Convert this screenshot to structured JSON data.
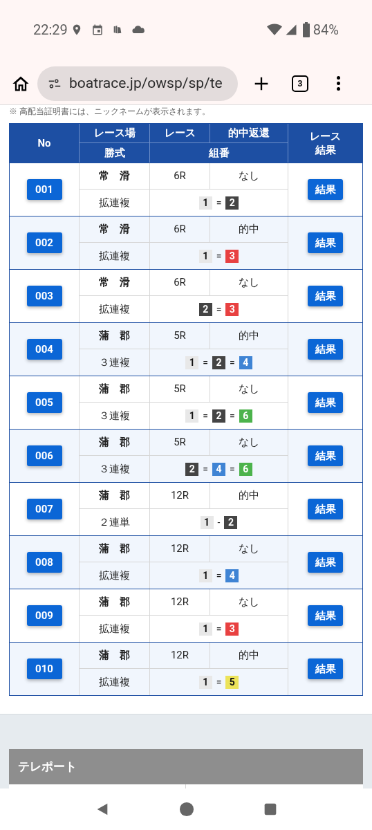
{
  "status_bar": {
    "time": "22:29",
    "battery": "84%"
  },
  "browser": {
    "url": "boatrace.jp/owsp/sp/te",
    "tab_count": "3"
  },
  "notice": "※ 高配当証明書には、ニックネームが表示されます。",
  "table": {
    "header": {
      "no": "No",
      "venue": "レース場",
      "race": "レース",
      "hit": "的中返還",
      "bet_type": "勝式",
      "combo": "組番",
      "result": [
        "レース",
        "結果"
      ]
    },
    "rows": [
      {
        "no": "001",
        "venue": "常　滑",
        "race": "6R",
        "hit": "なし",
        "bet_type": "拡連複",
        "separator": "=",
        "picks": [
          {
            "num": "1",
            "color": "#e8e8e8"
          },
          {
            "num": "2",
            "color": "#444444"
          }
        ],
        "button": "結果"
      },
      {
        "no": "002",
        "venue": "常　滑",
        "race": "6R",
        "hit": "的中",
        "bet_type": "拡連複",
        "separator": "=",
        "picks": [
          {
            "num": "1",
            "color": "#e8e8e8"
          },
          {
            "num": "3",
            "color": "#e84141"
          }
        ],
        "button": "結果"
      },
      {
        "no": "003",
        "venue": "常　滑",
        "race": "6R",
        "hit": "なし",
        "bet_type": "拡連複",
        "separator": "=",
        "picks": [
          {
            "num": "2",
            "color": "#444444"
          },
          {
            "num": "3",
            "color": "#e84141"
          }
        ],
        "button": "結果"
      },
      {
        "no": "004",
        "venue": "蒲　郡",
        "race": "5R",
        "hit": "的中",
        "bet_type": "３連複",
        "separator": "=",
        "picks": [
          {
            "num": "1",
            "color": "#e8e8e8"
          },
          {
            "num": "2",
            "color": "#444444"
          },
          {
            "num": "4",
            "color": "#3f84d4"
          }
        ],
        "button": "結果"
      },
      {
        "no": "005",
        "venue": "蒲　郡",
        "race": "5R",
        "hit": "なし",
        "bet_type": "３連複",
        "separator": "=",
        "picks": [
          {
            "num": "1",
            "color": "#e8e8e8"
          },
          {
            "num": "2",
            "color": "#444444"
          },
          {
            "num": "6",
            "color": "#4cb34c"
          }
        ],
        "button": "結果"
      },
      {
        "no": "006",
        "venue": "蒲　郡",
        "race": "5R",
        "hit": "なし",
        "bet_type": "３連複",
        "separator": "=",
        "picks": [
          {
            "num": "2",
            "color": "#444444"
          },
          {
            "num": "4",
            "color": "#3f84d4"
          },
          {
            "num": "6",
            "color": "#4cb34c"
          }
        ],
        "button": "結果"
      },
      {
        "no": "007",
        "venue": "蒲　郡",
        "race": "12R",
        "hit": "的中",
        "bet_type": "２連単",
        "separator": "-",
        "picks": [
          {
            "num": "1",
            "color": "#e8e8e8"
          },
          {
            "num": "2",
            "color": "#444444"
          }
        ],
        "button": "結果"
      },
      {
        "no": "008",
        "venue": "蒲　郡",
        "race": "12R",
        "hit": "なし",
        "bet_type": "拡連複",
        "separator": "=",
        "picks": [
          {
            "num": "1",
            "color": "#e8e8e8"
          },
          {
            "num": "4",
            "color": "#3f84d4"
          }
        ],
        "button": "結果"
      },
      {
        "no": "009",
        "venue": "蒲　郡",
        "race": "12R",
        "hit": "なし",
        "bet_type": "拡連複",
        "separator": "=",
        "picks": [
          {
            "num": "1",
            "color": "#e8e8e8"
          },
          {
            "num": "3",
            "color": "#e84141"
          }
        ],
        "button": "結果"
      },
      {
        "no": "010",
        "venue": "蒲　郡",
        "race": "12R",
        "hit": "的中",
        "bet_type": "拡連複",
        "separator": "=",
        "picks": [
          {
            "num": "1",
            "color": "#e8e8e8"
          },
          {
            "num": "5",
            "color": "#ece35a"
          }
        ],
        "button": "結果"
      }
    ]
  },
  "section": {
    "title": "テレポート"
  }
}
